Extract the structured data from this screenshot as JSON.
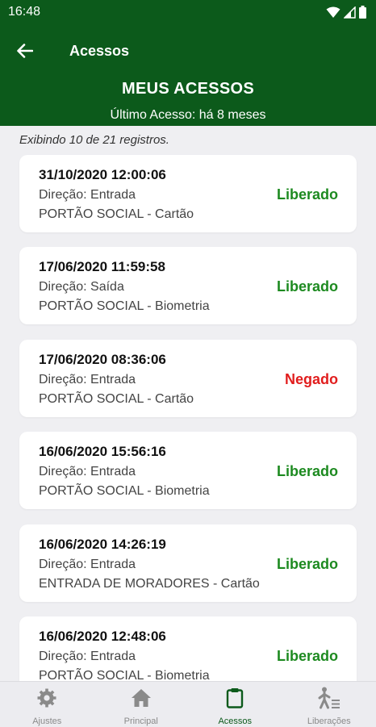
{
  "status_bar": {
    "time": "16:48"
  },
  "appbar": {
    "title": "Acessos"
  },
  "header": {
    "title": "MEUS ACESSOS",
    "subtitle": "Último Acesso: há 8 meses"
  },
  "list": {
    "count_text": "Exibindo 10 de 21 registros.",
    "items": [
      {
        "datetime": "31/10/2020 12:00:06",
        "direction": "Direção: Entrada",
        "location": "PORTÃO SOCIAL - Cartão",
        "status": "Liberado"
      },
      {
        "datetime": "17/06/2020 11:59:58",
        "direction": "Direção: Saída",
        "location": "PORTÃO SOCIAL - Biometria",
        "status": "Liberado"
      },
      {
        "datetime": "17/06/2020 08:36:06",
        "direction": "Direção: Entrada",
        "location": "PORTÃO SOCIAL - Cartão",
        "status": "Negado"
      },
      {
        "datetime": "16/06/2020 15:56:16",
        "direction": "Direção: Entrada",
        "location": "PORTÃO SOCIAL - Biometria",
        "status": "Liberado"
      },
      {
        "datetime": "16/06/2020 14:26:19",
        "direction": "Direção: Entrada",
        "location": "ENTRADA DE MORADORES - Cartão",
        "status": "Liberado"
      },
      {
        "datetime": "16/06/2020 12:48:06",
        "direction": "Direção: Entrada",
        "location": "PORTÃO SOCIAL - Biometria",
        "status": "Liberado"
      }
    ]
  },
  "bottom_nav": {
    "items": [
      {
        "label": "Ajustes",
        "icon": "gear-icon"
      },
      {
        "label": "Principal",
        "icon": "home-icon"
      },
      {
        "label": "Acessos",
        "icon": "clipboard-icon",
        "active": true
      },
      {
        "label": "Liberações",
        "icon": "person-list-icon"
      }
    ]
  },
  "colors": {
    "primary": "#0c5a1b",
    "liberado": "#1d8a20",
    "negado": "#e11d1d",
    "background": "#efeff2"
  }
}
